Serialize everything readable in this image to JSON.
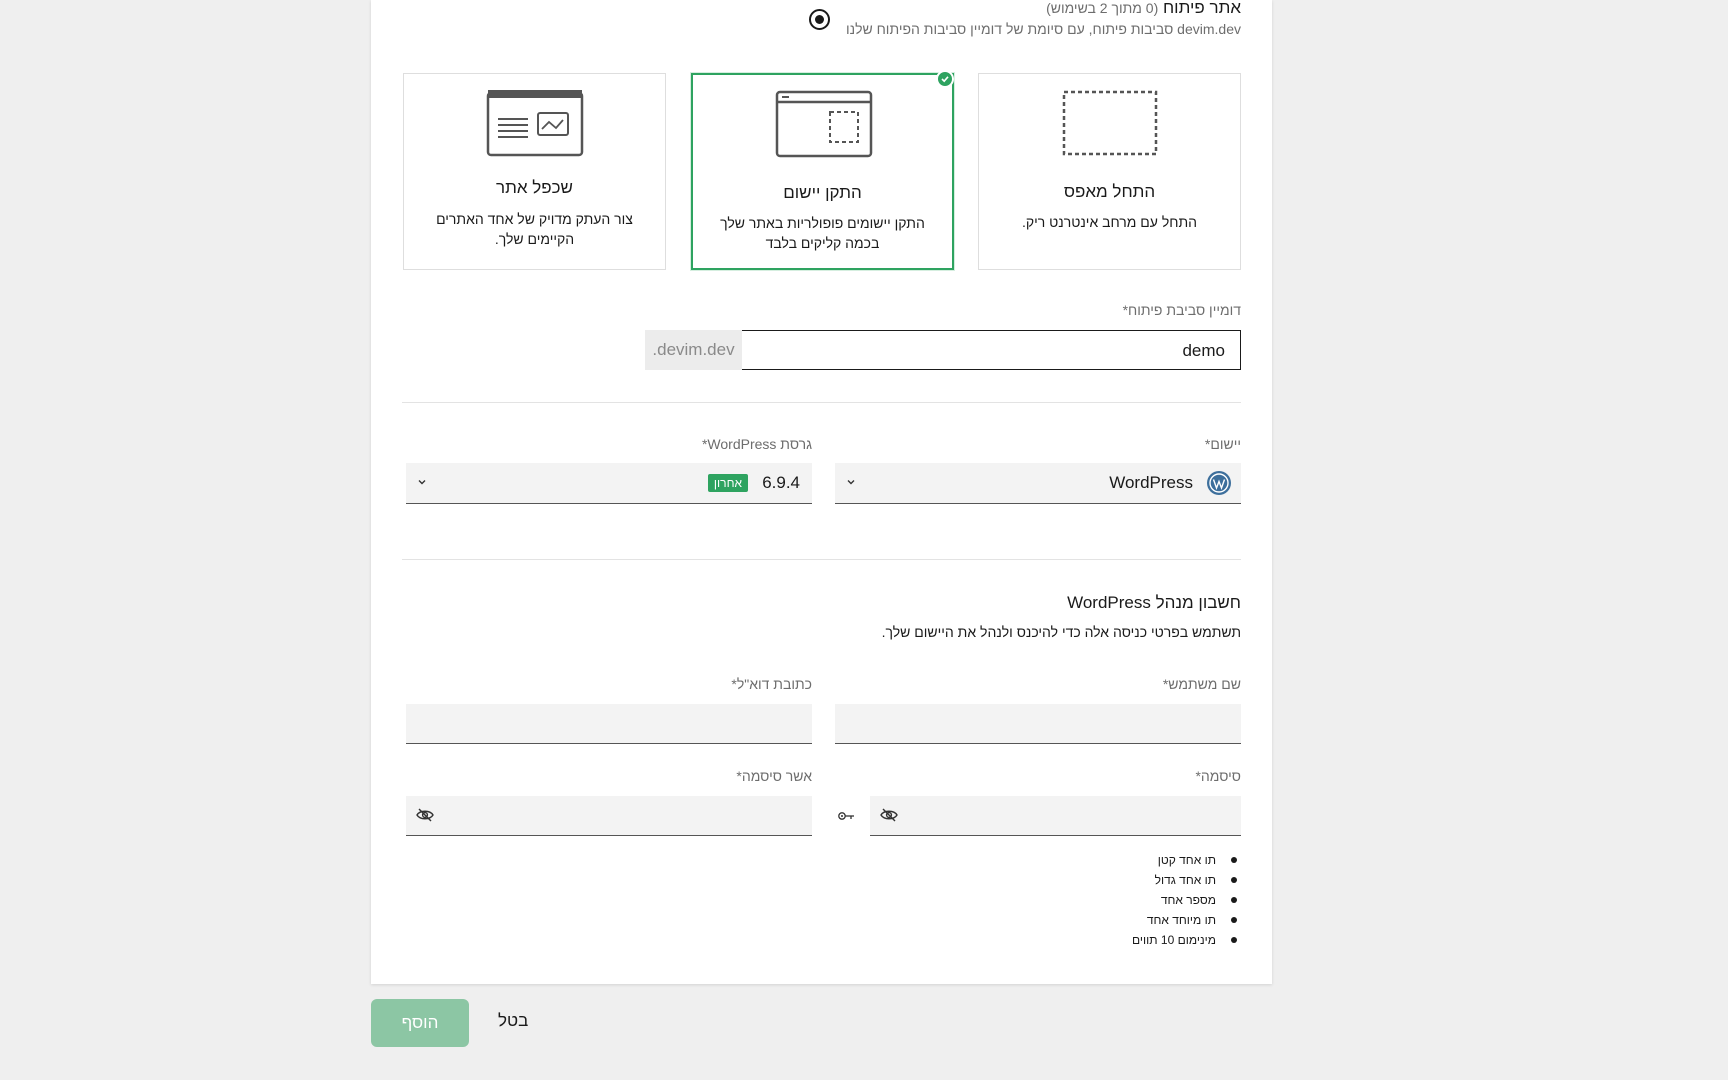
{
  "header": {
    "title": "אתר פיתוח",
    "count_note": "(0 מתוך 2 בשימוש)",
    "subtitle": "סביבות פיתוח, עם סיומת של דומיין סביבות הפיתוח שלנו devim.dev"
  },
  "options": [
    {
      "title": "התחל מאפס",
      "desc": "התחל עם מרחב אינטרנט ריק.",
      "icon": "blank-layout-icon",
      "selected": false
    },
    {
      "title": "התקן יישום",
      "desc": "התקן יישומים פופולריות באתר שלך בכמה קליקים בלבד",
      "icon": "install-app-icon",
      "selected": true
    },
    {
      "title": "שכפל אתר",
      "desc": "צור העתק מדויק של אחד האתרים הקיימים שלך.",
      "icon": "clone-site-icon",
      "selected": false
    }
  ],
  "domain": {
    "label": "דומיין סביבת פיתוח*",
    "value": "demo",
    "suffix": ".devim.dev"
  },
  "application": {
    "label": "יישום*",
    "value": "WordPress"
  },
  "wp_version": {
    "label": "גרסת WordPress*",
    "value": "6.9.4",
    "badge": "אחרון"
  },
  "admin": {
    "title": "חשבון מנהל WordPress",
    "description": "תשתמש בפרטי כניסה אלה כדי להיכנס ולנהל את היישום שלך.",
    "username_label": "שם משתמש*",
    "email_label": "כתובת דוא\"ל*",
    "password_label": "סיסמה*",
    "confirm_label": "אשר סיסמה*",
    "rules": [
      "תו אחד קטן",
      "תו אחד גדול",
      "מספר אחד",
      "תו מיוחד אחד",
      "מינימום 10 תווים"
    ]
  },
  "buttons": {
    "add": "הוסף",
    "cancel": "בטל"
  },
  "colors": {
    "accent": "#2ea360",
    "disabled_button": "#8cc6a4"
  }
}
